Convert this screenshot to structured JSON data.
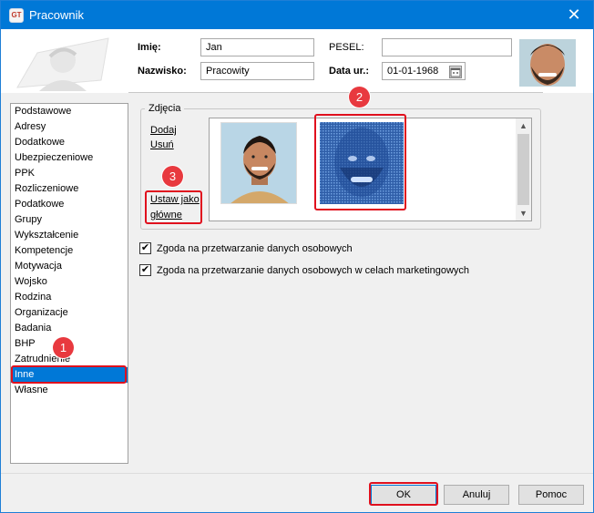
{
  "window": {
    "title": "Pracownik",
    "app_icon_text": "GT"
  },
  "form": {
    "first_name_label": "Imię:",
    "first_name_value": "Jan",
    "last_name_label": "Nazwisko:",
    "last_name_value": "Pracowity",
    "pesel_label": "PESEL:",
    "pesel_value": "",
    "birth_date_label": "Data ur.:",
    "birth_date_value": "01-01-1968"
  },
  "sidebar": {
    "items": [
      {
        "label": "Podstawowe"
      },
      {
        "label": "Adresy"
      },
      {
        "label": "Dodatkowe"
      },
      {
        "label": "Ubezpieczeniowe"
      },
      {
        "label": "PPK"
      },
      {
        "label": "Rozliczeniowe"
      },
      {
        "label": "Podatkowe"
      },
      {
        "label": "Grupy"
      },
      {
        "label": "Wykształcenie"
      },
      {
        "label": "Kompetencje"
      },
      {
        "label": "Motywacja"
      },
      {
        "label": "Wojsko"
      },
      {
        "label": "Rodzina"
      },
      {
        "label": "Organizacje"
      },
      {
        "label": "Badania"
      },
      {
        "label": "BHP"
      },
      {
        "label": "Zatrudnienie"
      },
      {
        "label": "Inne",
        "selected": true
      },
      {
        "label": "Własne"
      }
    ]
  },
  "photos": {
    "group_label": "Zdjęcia",
    "add_link": "Dodaj",
    "remove_link": "Usuń",
    "set_main_link_line1": "Ustaw jako",
    "set_main_link_line2": "główne"
  },
  "consents": {
    "data_processing": {
      "label": "Zgoda na przetwarzanie danych osobowych",
      "checked": true
    },
    "marketing": {
      "label": "Zgoda na przetwarzanie danych osobowych w celach marketingowych",
      "checked": true
    },
    "check_glyph": "✔"
  },
  "buttons": {
    "ok": "OK",
    "cancel": "Anuluj",
    "help": "Pomoc"
  },
  "callouts": {
    "one": "1",
    "two": "2",
    "three": "3"
  },
  "icons": {
    "close": "✕",
    "scroll_up": "▲",
    "scroll_down": "▼"
  },
  "colors": {
    "titlebar": "#0078d7",
    "selection": "#0078d7",
    "callout": "#e0101e"
  }
}
